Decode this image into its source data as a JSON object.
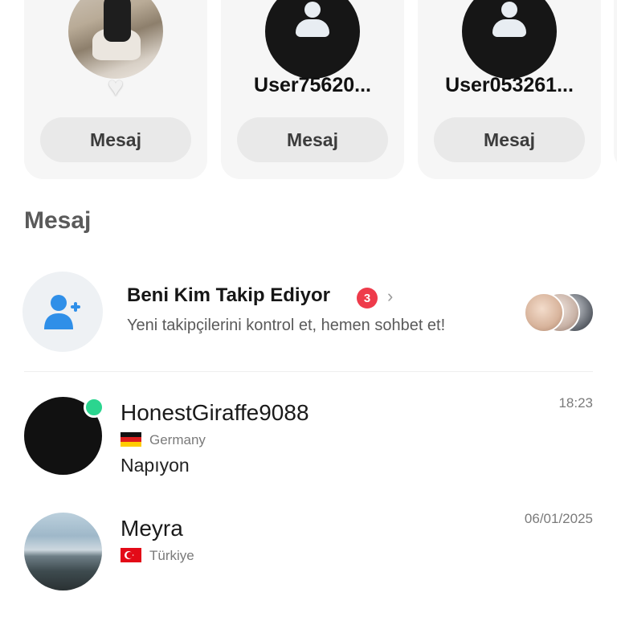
{
  "suggestions": [
    {
      "name": "",
      "liked": true,
      "heart_glyph": "♥",
      "message_label": "Mesaj"
    },
    {
      "name": "User75620...",
      "message_label": "Mesaj"
    },
    {
      "name": "User053261...",
      "message_label": "Mesaj"
    }
  ],
  "section": {
    "title": "Mesaj"
  },
  "followers": {
    "title": "Beni Kim Takip Ediyor",
    "count": "3",
    "chevron": "›",
    "subtitle": "Yeni takipçilerini kontrol et, hemen sohbet et!",
    "icon": "add-user-icon",
    "accent": "#2f8fe8"
  },
  "chats": [
    {
      "name": "HonestGiraffe9088",
      "country": "Germany",
      "preview": "Napıyon",
      "time": "18:23",
      "online": true
    },
    {
      "name": "Meyra",
      "country": "Türkiye",
      "preview": "",
      "time": "06/01/2025",
      "online": false
    }
  ],
  "colors": {
    "badge": "#ee3b4b",
    "online": "#2bd58f",
    "button_bg": "#e9e9e9",
    "card_bg": "#f6f6f6"
  }
}
